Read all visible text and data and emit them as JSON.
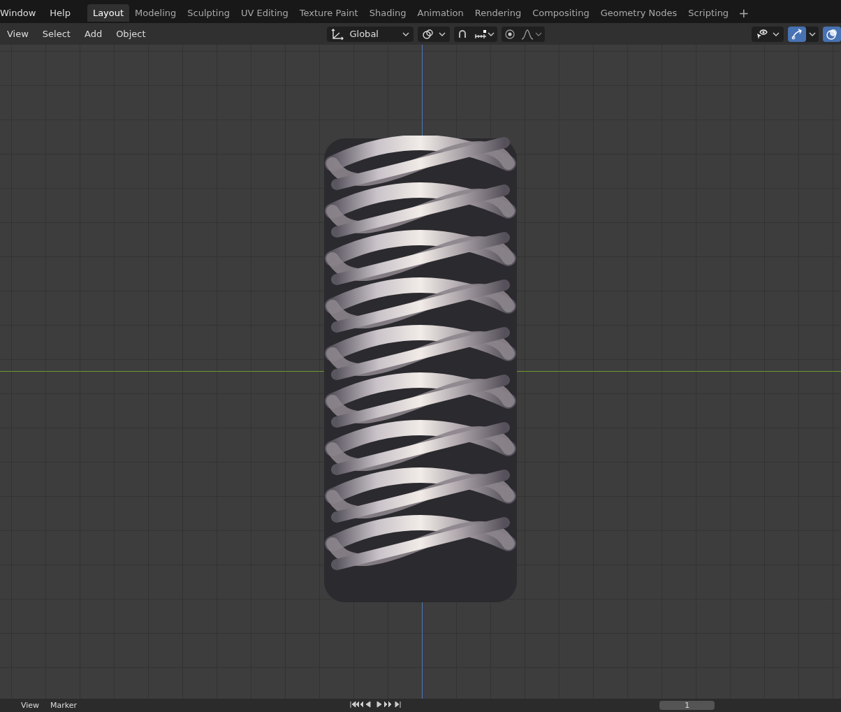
{
  "menu": [
    "Window",
    "Help"
  ],
  "workspaces": [
    {
      "label": "Layout",
      "selected": true
    },
    {
      "label": "Modeling",
      "selected": false
    },
    {
      "label": "Sculpting",
      "selected": false
    },
    {
      "label": "UV Editing",
      "selected": false
    },
    {
      "label": "Texture Paint",
      "selected": false
    },
    {
      "label": "Shading",
      "selected": false
    },
    {
      "label": "Animation",
      "selected": false
    },
    {
      "label": "Rendering",
      "selected": false
    },
    {
      "label": "Compositing",
      "selected": false
    },
    {
      "label": "Geometry Nodes",
      "selected": false
    },
    {
      "label": "Scripting",
      "selected": false
    }
  ],
  "add_workspace": "+",
  "viewport_menu": [
    "View",
    "Select",
    "Add",
    "Object"
  ],
  "orientation": {
    "value": "Global"
  },
  "snap": {
    "on": false
  },
  "proportional": {
    "on": false
  },
  "gizmos": {
    "on": true
  },
  "overlays": {
    "on": true
  },
  "timeline": {
    "menu": [
      "View",
      "Marker"
    ],
    "frame": "1"
  }
}
